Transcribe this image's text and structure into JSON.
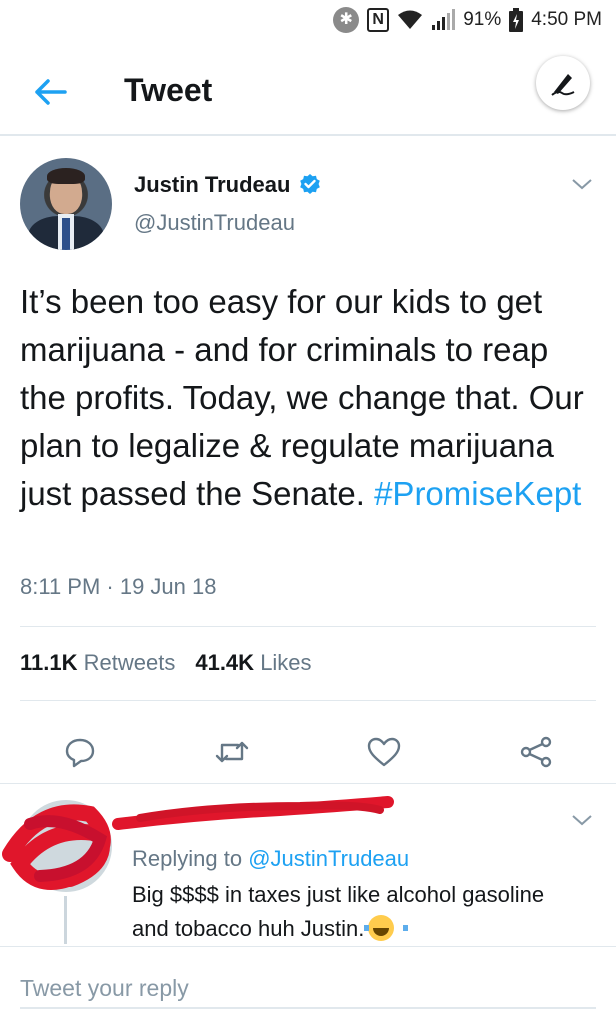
{
  "status_bar": {
    "bluetooth_icon": "bluetooth-icon",
    "nfc_icon": "nfc-icon",
    "nfc_label": "N",
    "battery_percent": "91%",
    "time": "4:50 PM"
  },
  "header": {
    "title": "Tweet"
  },
  "tweet": {
    "display_name": "Justin Trudeau",
    "handle": "@JustinTrudeau",
    "text_plain": "It’s been too easy for our kids to get marijuana - and for criminals to reap the profits. Today, we change that. Our plan to legalize & regulate marijuana just passed the Senate. ",
    "hashtag": "#PromiseKept",
    "timestamp": "8:11 PM · 19 Jun 18",
    "retweets_count": "11.1K",
    "retweets_label": "Retweets",
    "likes_count": "41.4K",
    "likes_label": "Likes"
  },
  "reply": {
    "replying_prefix": "Replying to",
    "replying_to": "@JustinTrudeau",
    "text": "Big  $$$$ in taxes just like alcohol gasoline and tobacco huh Justin."
  },
  "composer": {
    "placeholder": "Tweet your reply"
  },
  "colors": {
    "accent": "#1da1f2",
    "secondary_text": "#657786",
    "redaction": "#e0162b"
  }
}
